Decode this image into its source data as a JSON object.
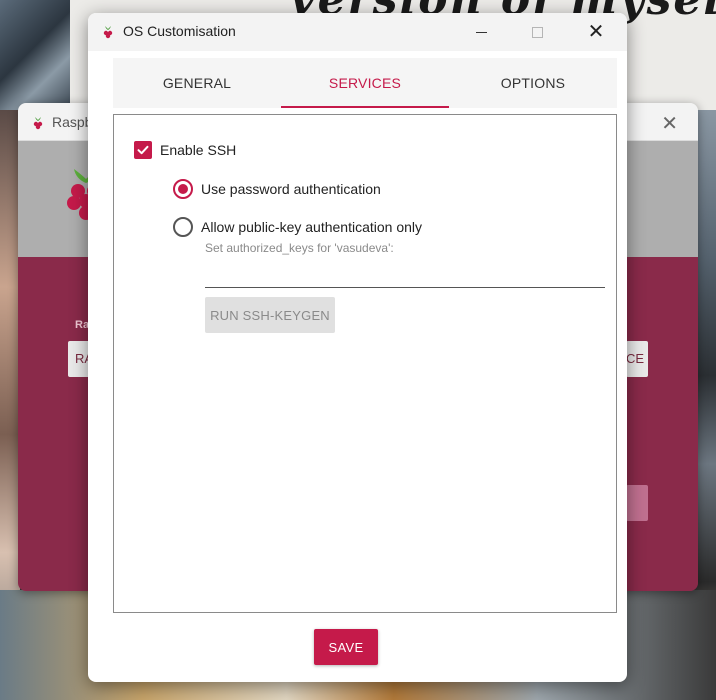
{
  "background": {
    "poster_text": "version of myself.",
    "imager_window": {
      "title": "Raspb",
      "left_label": "Ra",
      "left_button": "RA",
      "right_button": "CE"
    }
  },
  "dialog": {
    "title": "OS Customisation",
    "tabs": [
      {
        "label": "GENERAL",
        "active": false
      },
      {
        "label": "SERVICES",
        "active": true
      },
      {
        "label": "OPTIONS",
        "active": false
      }
    ],
    "ssh": {
      "enable_label": "Enable SSH",
      "enabled": true,
      "password_auth_label": "Use password authentication",
      "password_auth_selected": true,
      "pubkey_auth_label": "Allow public-key authentication only",
      "pubkey_auth_selected": false,
      "authorized_keys_label": "Set authorized_keys for 'vasudeva':",
      "authorized_keys_value": "",
      "keygen_button": "RUN SSH-KEYGEN"
    },
    "save_button": "SAVE"
  },
  "colors": {
    "accent": "#c51a4a",
    "imager_body": "#8a2a4a"
  },
  "icons": {
    "app_icon": "raspberry-pi-icon",
    "check": "checkmark-icon",
    "close": "close-icon",
    "minimize": "minimize-icon",
    "maximize": "maximize-icon"
  }
}
